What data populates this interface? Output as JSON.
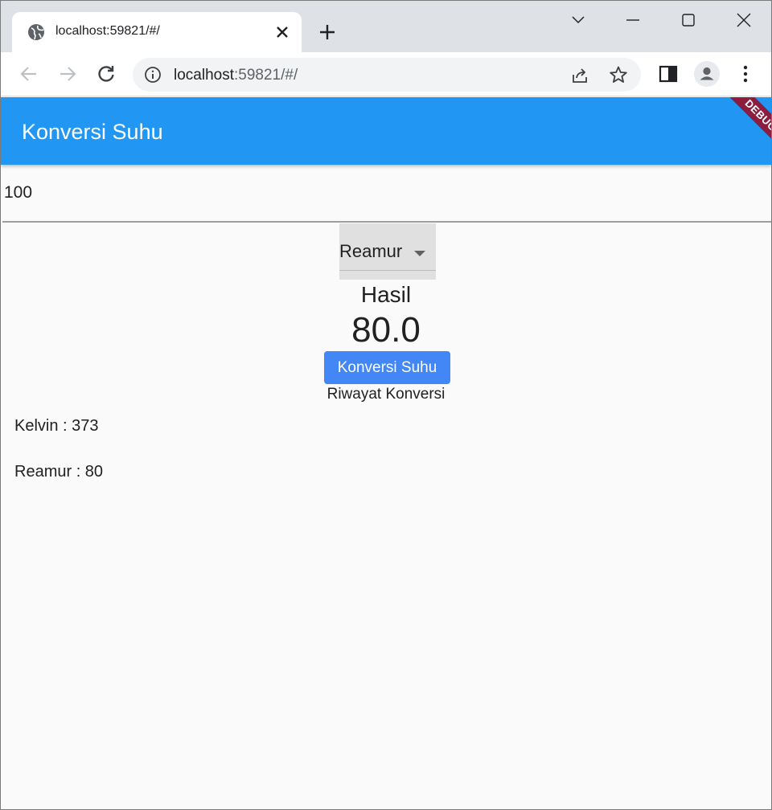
{
  "browser": {
    "tab_title": "localhost:59821/#/",
    "url_host": "localhost",
    "url_rest": ":59821/#/"
  },
  "app": {
    "title": "Konversi Suhu",
    "debug_banner": "DEBUG",
    "input_value": "100",
    "dropdown_selected": "Reamur",
    "result_label": "Hasil",
    "result_value": "80.0",
    "convert_button": "Konversi Suhu",
    "history_title": "Riwayat Konversi",
    "history": [
      "Kelvin : 373",
      "Reamur : 80"
    ]
  },
  "colors": {
    "appbar": "#2196f3",
    "button": "#4287f5",
    "debug_banner": "#8b1e3f",
    "tabstrip": "#dee1e6"
  },
  "icons": [
    "globe-icon",
    "close-icon",
    "plus-icon",
    "chevron-down-icon",
    "minimize-icon",
    "maximize-icon",
    "window-close-icon",
    "back-arrow-icon",
    "forward-arrow-icon",
    "reload-icon",
    "info-icon",
    "share-icon",
    "star-icon",
    "side-panel-icon",
    "profile-icon",
    "more-vert-icon",
    "dropdown-arrow-icon"
  ]
}
